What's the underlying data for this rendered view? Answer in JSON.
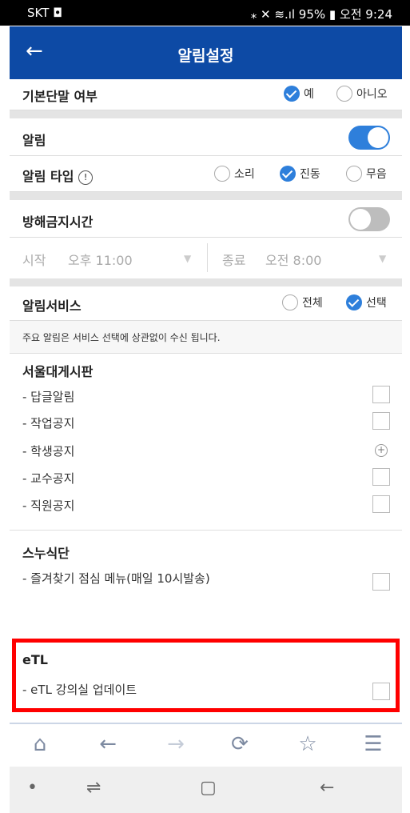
{
  "status_bar": {
    "carrier": "SKT ◘",
    "right": "⁎ ✕ ≋.ıl 95% ▮ 오전 9:24"
  },
  "app_bar": {
    "back_icon": "←",
    "title": "알림설정"
  },
  "default_device": {
    "label": "기본단말 여부",
    "options": [
      "예",
      "아니오"
    ],
    "selected": "예"
  },
  "alarm": {
    "label": "알림",
    "enabled": true
  },
  "alarm_type": {
    "label": "알림 타입",
    "info_icon": "!",
    "options": [
      "소리",
      "진동",
      "무음"
    ],
    "selected": "진동"
  },
  "do_not_disturb": {
    "label": "방해금지시간",
    "enabled": false,
    "start_label": "시작",
    "start_value": "오후 11:00",
    "end_label": "종료",
    "end_value": "오전 8:00",
    "dropdown_icon": "▼"
  },
  "alarm_service": {
    "label": "알림서비스",
    "options": [
      "전체",
      "선택"
    ],
    "selected": "선택",
    "notice": "주요 알림은 서비스 선택에 상관없이 수신 됩니다."
  },
  "sections": {
    "board": {
      "title": "서울대게시판",
      "items": [
        "- 답글알림",
        "- 작업공지",
        "- 학생공지",
        "- 교수공지",
        "- 직원공지"
      ]
    },
    "snuco": {
      "title": "스누식단",
      "items": [
        "- 즐겨찾기 점심 메뉴(매일 10시발송)"
      ]
    },
    "etl": {
      "title": "eTL",
      "items": [
        "- eTL 강의실 업데이트"
      ]
    }
  },
  "toolbar": {
    "home_icon": "⌂",
    "back_icon": "←",
    "forward_icon": "→",
    "refresh_icon": "⟳",
    "bookmark_icon": "☆",
    "menu_icon": "☰"
  },
  "nav_bar": {
    "dot_icon": "•",
    "recents_icon": "⇌",
    "home_icon": "▢",
    "back_icon": "←"
  },
  "colors": {
    "app_bar": "#0d4aa5",
    "accent": "#2e7fdb",
    "highlight": "#ff0000"
  }
}
